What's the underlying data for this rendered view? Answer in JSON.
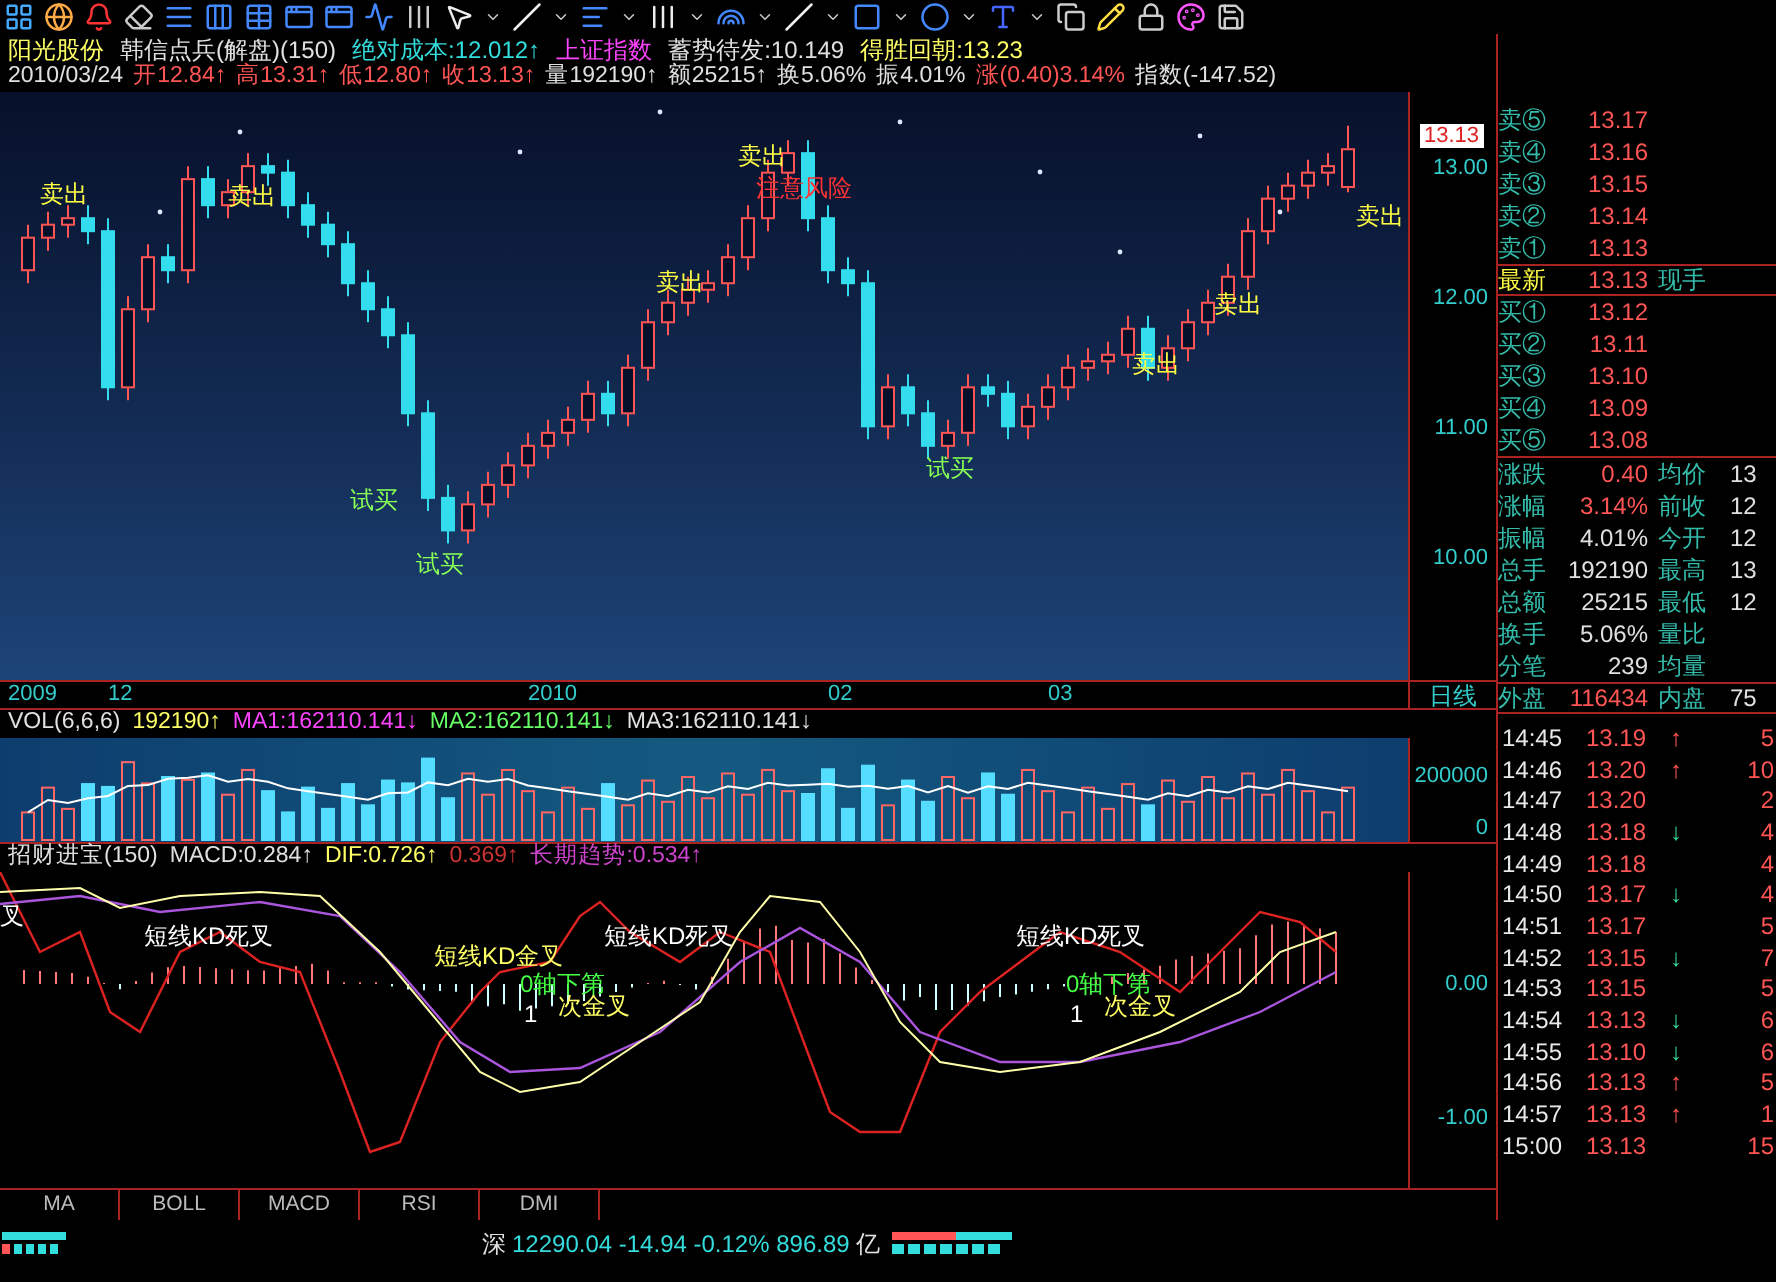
{
  "stock_header": {
    "line_1": [
      {
        "text": "阳光股份",
        "color": "#ffff66"
      },
      {
        "text": "韩信点兵(解盘)(150)",
        "color": "#e0e0e0"
      },
      {
        "text": "绝对成本:12.012↑",
        "color": "#33dddd"
      },
      {
        "text": "上证指数",
        "color": "#ff44ff"
      },
      {
        "text": "蓄势待发:10.149",
        "color": "#e0e0e0"
      },
      {
        "text": "得胜回朝:13.23",
        "color": "#ffff66"
      }
    ],
    "line_2": [
      {
        "text": "2010/03/24",
        "color": "#e0e0e0"
      },
      {
        "text": "开12.84↑",
        "color": "#ff5555"
      },
      {
        "text": "高13.31↑",
        "color": "#ff5555"
      },
      {
        "text": "低12.80↑",
        "color": "#ff5555"
      },
      {
        "text": "收13.13↑",
        "color": "#ff5555"
      },
      {
        "text": "量192190↑",
        "color": "#e0e0e0"
      },
      {
        "text": "额25215↑",
        "color": "#e0e0e0"
      },
      {
        "text": "换5.06%",
        "color": "#e0e0e0"
      },
      {
        "text": "振4.01%",
        "color": "#e0e0e0"
      },
      {
        "text": "涨(0.40)3.14%",
        "color": "#ff5555"
      },
      {
        "text": "指数(-147.52)",
        "color": "#e0e0e0"
      }
    ]
  },
  "price_chart": {
    "annotations": [
      {
        "text": "卖出",
        "kind": "sell"
      },
      {
        "text": "卖出",
        "kind": "sell"
      },
      {
        "text": "卖出",
        "kind": "sell"
      },
      {
        "text": "卖出",
        "kind": "sell"
      },
      {
        "text": "注意风险",
        "kind": "risk"
      },
      {
        "text": "卖出",
        "kind": "sell"
      },
      {
        "text": "卖出",
        "kind": "sell"
      },
      {
        "text": "卖出",
        "kind": "sell"
      },
      {
        "text": "试买",
        "kind": "buy"
      },
      {
        "text": "试买",
        "kind": "buy"
      },
      {
        "text": "试买",
        "kind": "buy"
      }
    ],
    "current_price": "13.13",
    "chart_data": {
      "type": "candlestick",
      "ohlc": [
        [
          12.2,
          12.55,
          12.1,
          12.45
        ],
        [
          12.45,
          12.65,
          12.35,
          12.55
        ],
        [
          12.55,
          12.7,
          12.45,
          12.6
        ],
        [
          12.6,
          12.7,
          12.4,
          12.5
        ],
        [
          12.5,
          12.6,
          11.2,
          11.3
        ],
        [
          11.3,
          12.0,
          11.2,
          11.9
        ],
        [
          11.9,
          12.4,
          11.8,
          12.3
        ],
        [
          12.3,
          12.4,
          12.1,
          12.2
        ],
        [
          12.2,
          13.0,
          12.1,
          12.9
        ],
        [
          12.9,
          13.0,
          12.6,
          12.7
        ],
        [
          12.7,
          12.9,
          12.6,
          12.8
        ],
        [
          12.8,
          13.1,
          12.7,
          13.0
        ],
        [
          13.0,
          13.1,
          12.85,
          12.95
        ],
        [
          12.95,
          13.05,
          12.6,
          12.7
        ],
        [
          12.7,
          12.8,
          12.45,
          12.55
        ],
        [
          12.55,
          12.65,
          12.3,
          12.4
        ],
        [
          12.4,
          12.5,
          12.0,
          12.1
        ],
        [
          12.1,
          12.2,
          11.8,
          11.9
        ],
        [
          11.9,
          12.0,
          11.6,
          11.7
        ],
        [
          11.7,
          11.8,
          11.0,
          11.1
        ],
        [
          11.1,
          11.2,
          10.35,
          10.45
        ],
        [
          10.45,
          10.55,
          10.1,
          10.2
        ],
        [
          10.2,
          10.5,
          10.1,
          10.4
        ],
        [
          10.4,
          10.65,
          10.3,
          10.55
        ],
        [
          10.55,
          10.8,
          10.45,
          10.7
        ],
        [
          10.7,
          10.95,
          10.6,
          10.85
        ],
        [
          10.85,
          11.05,
          10.75,
          10.95
        ],
        [
          10.95,
          11.15,
          10.85,
          11.05
        ],
        [
          11.05,
          11.35,
          10.95,
          11.25
        ],
        [
          11.25,
          11.35,
          11.0,
          11.1
        ],
        [
          11.1,
          11.55,
          11.0,
          11.45
        ],
        [
          11.45,
          11.9,
          11.35,
          11.8
        ],
        [
          11.8,
          12.05,
          11.7,
          11.95
        ],
        [
          11.95,
          12.15,
          11.85,
          12.05
        ],
        [
          12.05,
          12.2,
          11.95,
          12.1
        ],
        [
          12.1,
          12.4,
          12.0,
          12.3
        ],
        [
          12.3,
          12.7,
          12.2,
          12.6
        ],
        [
          12.6,
          13.05,
          12.5,
          12.95
        ],
        [
          12.95,
          13.2,
          12.85,
          13.1
        ],
        [
          13.1,
          13.2,
          12.5,
          12.6
        ],
        [
          12.6,
          12.7,
          12.1,
          12.2
        ],
        [
          12.2,
          12.3,
          12.0,
          12.1
        ],
        [
          12.1,
          12.2,
          10.9,
          11.0
        ],
        [
          11.0,
          11.4,
          10.9,
          11.3
        ],
        [
          11.3,
          11.4,
          11.0,
          11.1
        ],
        [
          11.1,
          11.2,
          10.75,
          10.85
        ],
        [
          10.85,
          11.05,
          10.75,
          10.95
        ],
        [
          10.95,
          11.4,
          10.85,
          11.3
        ],
        [
          11.3,
          11.4,
          11.15,
          11.25
        ],
        [
          11.25,
          11.35,
          10.9,
          11.0
        ],
        [
          11.0,
          11.25,
          10.9,
          11.15
        ],
        [
          11.15,
          11.4,
          11.05,
          11.3
        ],
        [
          11.3,
          11.55,
          11.2,
          11.45
        ],
        [
          11.45,
          11.6,
          11.35,
          11.5
        ],
        [
          11.5,
          11.65,
          11.4,
          11.55
        ],
        [
          11.55,
          11.85,
          11.45,
          11.75
        ],
        [
          11.75,
          11.85,
          11.35,
          11.45
        ],
        [
          11.45,
          11.7,
          11.35,
          11.6
        ],
        [
          11.6,
          11.9,
          11.5,
          11.8
        ],
        [
          11.8,
          12.05,
          11.7,
          11.95
        ],
        [
          11.95,
          12.25,
          11.85,
          12.15
        ],
        [
          12.15,
          12.6,
          12.05,
          12.5
        ],
        [
          12.5,
          12.85,
          12.4,
          12.75
        ],
        [
          12.75,
          12.95,
          12.65,
          12.85
        ],
        [
          12.85,
          13.05,
          12.75,
          12.95
        ],
        [
          12.95,
          13.1,
          12.85,
          13.0
        ],
        [
          12.84,
          13.31,
          12.8,
          13.13
        ]
      ],
      "ylim": [
        9.05,
        13.57
      ],
      "yticks": [
        {
          "value": 13,
          "label": "13.00"
        },
        {
          "value": 12,
          "label": "12.00"
        },
        {
          "value": 11,
          "label": "11.00"
        },
        {
          "value": 10,
          "label": "10.00"
        }
      ]
    }
  },
  "date_axis": [
    "2009",
    "12",
    "2010",
    "02",
    "03"
  ],
  "period_label": "日线",
  "volume": {
    "header": [
      {
        "text": "VOL(6,6,6)",
        "color": "#e0e0e0"
      },
      {
        "text": "192190↑",
        "color": "#ffff66"
      },
      {
        "text": "MA1:162110.141↓",
        "color": "#ff44ff"
      },
      {
        "text": "MA2:162110.141↓",
        "color": "#66ff66"
      },
      {
        "text": "MA3:162110.141↓",
        "color": "#e0e0e0"
      }
    ],
    "axis_labels": [
      "200000",
      "0"
    ]
  },
  "macd": {
    "header": [
      {
        "text": "招财进宝(150)",
        "color": "#e0e0e0"
      },
      {
        "text": "MACD:0.284↑",
        "color": "#e0e0e0"
      },
      {
        "text": "DIF:0.726↑",
        "color": "#ffff66"
      },
      {
        "text": "0.369↑",
        "color": "#cc3333"
      },
      {
        "text": "长期趋势:0.534↑",
        "color": "#cc44cc"
      }
    ],
    "annotations": [
      {
        "text": "叉",
        "kind": "dead"
      },
      {
        "text": "短线KD死叉",
        "kind": "dead"
      },
      {
        "text": "短线KD金叉",
        "kind": "golden"
      },
      {
        "text": "0轴下第",
        "kind": "axis"
      },
      {
        "text": "1",
        "kind": "count"
      },
      {
        "text": "次金叉",
        "kind": "golden"
      },
      {
        "text": "短线KD死叉",
        "kind": "dead"
      },
      {
        "text": "短线KD死叉",
        "kind": "dead"
      },
      {
        "text": "0轴下第",
        "kind": "axis"
      },
      {
        "text": "1",
        "kind": "count"
      },
      {
        "text": "次金叉",
        "kind": "golden"
      }
    ],
    "axis_labels": [
      "0.00",
      "-1.00"
    ]
  },
  "indicator_tabs": [
    "MA",
    "BOLL",
    "MACD",
    "RSI",
    "DMI"
  ],
  "quote": {
    "order_book": [
      {
        "label": "卖⑤",
        "price": "13.17",
        "kind": "ask"
      },
      {
        "label": "卖④",
        "price": "13.16",
        "kind": "ask"
      },
      {
        "label": "卖③",
        "price": "13.15",
        "kind": "ask"
      },
      {
        "label": "卖②",
        "price": "13.14",
        "kind": "ask"
      },
      {
        "label": "卖①",
        "price": "13.13",
        "kind": "ask"
      },
      {
        "label": "最新",
        "price": "13.13",
        "kind": "last",
        "extra": "现手"
      },
      {
        "label": "买①",
        "price": "13.12",
        "kind": "bid"
      },
      {
        "label": "买②",
        "price": "13.11",
        "kind": "bid"
      },
      {
        "label": "买③",
        "price": "13.10",
        "kind": "bid"
      },
      {
        "label": "买④",
        "price": "13.09",
        "kind": "bid"
      },
      {
        "label": "买⑤",
        "price": "13.08",
        "kind": "bid"
      }
    ],
    "stats": [
      {
        "label_1": "涨跌",
        "value_1": "0.40",
        "color": "#ff5555",
        "label_2": "均价",
        "value_2": "13"
      },
      {
        "label_1": "涨幅",
        "value_1": "3.14%",
        "color": "#ff5555",
        "label_2": "前收",
        "value_2": "12"
      },
      {
        "label_1": "振幅",
        "value_1": "4.01%",
        "color": "#e0e0e0",
        "label_2": "今开",
        "value_2": "12"
      },
      {
        "label_1": "总手",
        "value_1": "192190",
        "color": "#e0e0e0",
        "label_2": "最高",
        "value_2": "13"
      },
      {
        "label_1": "总额",
        "value_1": "25215",
        "color": "#e0e0e0",
        "label_2": "最低",
        "value_2": "12"
      },
      {
        "label_1": "换手",
        "value_1": "5.06%",
        "color": "#e0e0e0",
        "label_2": "量比"
      },
      {
        "label_1": "分笔",
        "value_1": "239",
        "color": "#e0e0e0",
        "label_2": "均量"
      }
    ],
    "trade_summary": {
      "label_1": "外盘",
      "value_1": "116434",
      "label_2": "内盘",
      "value_2": "75"
    },
    "ticks": [
      {
        "time": "14:45",
        "price": "13.19",
        "arrow": "↑",
        "rising": true,
        "volume": "5"
      },
      {
        "time": "14:46",
        "price": "13.20",
        "arrow": "↑",
        "rising": true,
        "volume": "10"
      },
      {
        "time": "14:47",
        "price": "13.20",
        "volume": "2"
      },
      {
        "time": "14:48",
        "price": "13.18",
        "arrow": "↓",
        "rising": false,
        "volume": "4"
      },
      {
        "time": "14:49",
        "price": "13.18",
        "volume": "4"
      },
      {
        "time": "14:50",
        "price": "13.17",
        "arrow": "↓",
        "rising": false,
        "volume": "4"
      },
      {
        "time": "14:51",
        "price": "13.17",
        "volume": "5"
      },
      {
        "time": "14:52",
        "price": "13.15",
        "arrow": "↓",
        "rising": false,
        "volume": "7"
      },
      {
        "time": "14:53",
        "price": "13.15",
        "volume": "5"
      },
      {
        "time": "14:54",
        "price": "13.13",
        "arrow": "↓",
        "rising": false,
        "volume": "6"
      },
      {
        "time": "14:55",
        "price": "13.10",
        "arrow": "↓",
        "rising": false,
        "volume": "6"
      },
      {
        "time": "14:56",
        "price": "13.13",
        "arrow": "↑",
        "rising": true,
        "volume": "5"
      },
      {
        "time": "14:57",
        "price": "13.13",
        "arrow": "↑",
        "rising": true,
        "volume": "1"
      },
      {
        "time": "15:00",
        "price": "13.13",
        "volume": "15"
      }
    ]
  },
  "status_bar": {
    "market": "深",
    "quote": "12290.04 -14.94 -0.12% 896.89",
    "unit": "亿"
  }
}
